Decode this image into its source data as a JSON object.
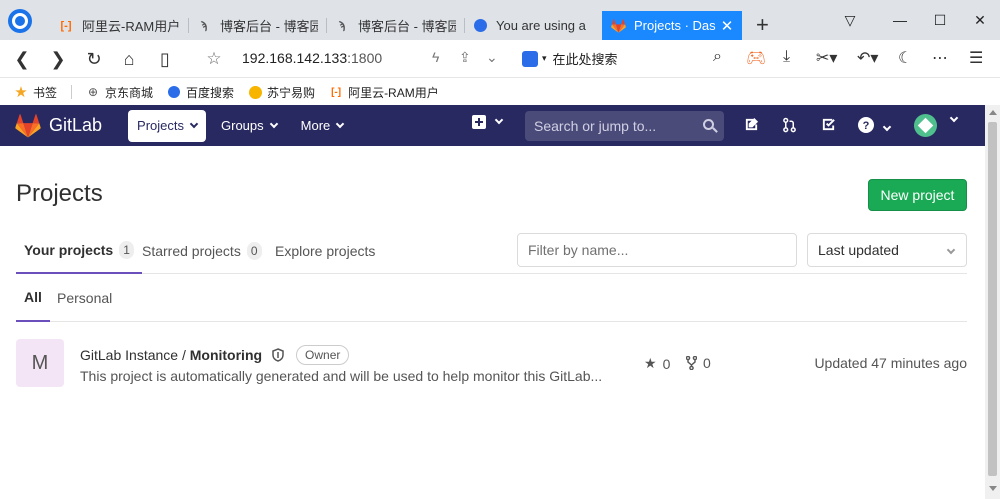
{
  "browser": {
    "tabs": [
      {
        "title": "阿里云-RAM用户",
        "icon": "aliyun-icon",
        "color": "#ff6a00"
      },
      {
        "title": "博客后台 - 博客园",
        "icon": "cnblogs-icon",
        "color": "#555555"
      },
      {
        "title": "博客后台 - 博客园",
        "icon": "cnblogs-icon",
        "color": "#555555"
      },
      {
        "title": "You are using a",
        "icon": "baidu-paw-icon",
        "color": "#2b6de8"
      },
      {
        "title": "Projects · Dash",
        "icon": "gitlab-icon",
        "color": "#fc6d26",
        "active": true
      }
    ],
    "new_tab": "+",
    "url_host": "192.168.142.133",
    "url_port": ":1800",
    "search_engine_placeholder": "在此处搜索",
    "bookmarks": [
      {
        "label": "书签",
        "icon": "star-icon"
      },
      {
        "label": "京东商城",
        "icon": "globe-icon"
      },
      {
        "label": "百度搜索",
        "icon": "baidu-paw-icon"
      },
      {
        "label": "苏宁易购",
        "icon": "suning-icon"
      },
      {
        "label": "阿里云-RAM用户",
        "icon": "aliyun-icon"
      }
    ]
  },
  "gitlab": {
    "brand": "GitLab",
    "nav": [
      {
        "label": "Projects",
        "active": true
      },
      {
        "label": "Groups"
      },
      {
        "label": "More"
      }
    ],
    "search_placeholder": "Search or jump to...",
    "page_title": "Projects",
    "new_project_label": "New project",
    "tabs": [
      {
        "label": "Your projects",
        "count": "1",
        "active": true
      },
      {
        "label": "Starred projects",
        "count": "0"
      },
      {
        "label": "Explore projects"
      }
    ],
    "filter_placeholder": "Filter by name...",
    "sort_value": "Last updated",
    "subtabs": [
      {
        "label": "All",
        "active": true
      },
      {
        "label": "Personal"
      }
    ],
    "projects": [
      {
        "avatar_letter": "M",
        "namespace": "GitLab Instance / ",
        "name": "Monitoring",
        "role": "Owner",
        "description": "This project is automatically generated and will be used to help monitor this GitLab...",
        "stars": "0",
        "forks": "0",
        "updated": "Updated 47 minutes ago"
      }
    ]
  },
  "colors": {
    "header": "#292961",
    "primary_green": "#1aaa55",
    "tab_underline": "#6b4fbb",
    "browser_active_tab": "#1a88ff"
  }
}
